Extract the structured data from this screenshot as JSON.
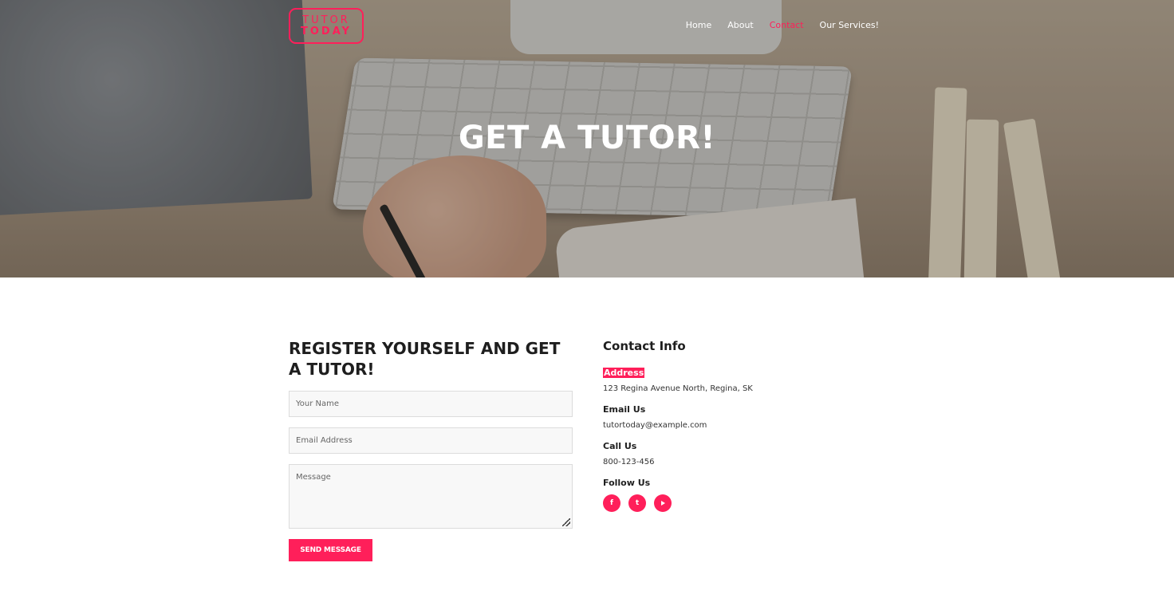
{
  "brand": {
    "line1": "TUTOR",
    "line2": "TODAY",
    "accent_color": "#ff1f5a"
  },
  "nav": {
    "items": [
      {
        "label": "Home",
        "active": false
      },
      {
        "label": "About",
        "active": false
      },
      {
        "label": "Contact",
        "active": true
      },
      {
        "label": "Our Services!",
        "active": false
      }
    ]
  },
  "hero": {
    "title": "GET A TUTOR!"
  },
  "form": {
    "heading": "REGISTER YOURSELF AND GET A TUTOR!",
    "name_placeholder": "Your Name",
    "email_placeholder": "Email Address",
    "message_placeholder": "Message",
    "submit_label": "SEND MESSAGE"
  },
  "contact": {
    "title": "Contact Info",
    "address_label": "Address",
    "address": "123 Regina Avenue North, Regina, SK",
    "email_label": "Email Us",
    "email": "tutortoday@example.com",
    "phone_label": "Call Us",
    "phone": "800-123-456",
    "follow_label": "Follow Us",
    "social": [
      {
        "icon": "facebook-icon",
        "glyph": "f"
      },
      {
        "icon": "twitter-icon",
        "glyph": "t"
      },
      {
        "icon": "youtube-icon",
        "glyph": ""
      }
    ]
  }
}
